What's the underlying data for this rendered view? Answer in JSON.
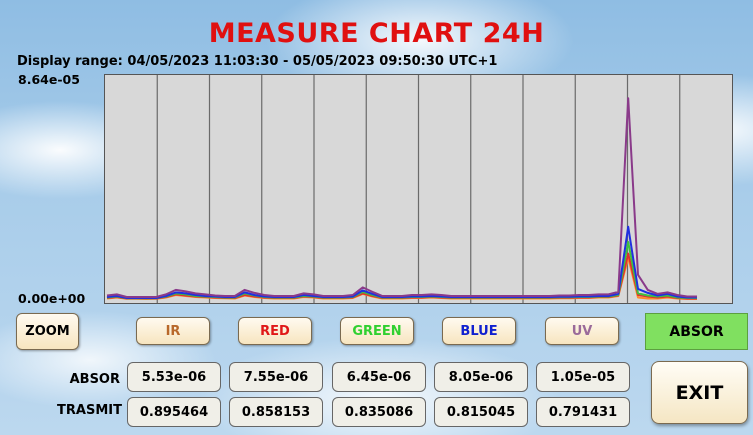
{
  "title": "MEASURE CHART 24H",
  "display_range": "Display range: 04/05/2023 11:03:30 - 05/05/2023 09:50:30 UTC+1",
  "chart_data": {
    "type": "line",
    "y_tick_max": "8.64e-05",
    "y_tick_min": "0.00e+00",
    "ylim": [
      0,
      8.64e-05
    ],
    "x_start": "04/05/2023 11:03:30",
    "x_end": "05/05/2023 09:50:30",
    "vertical_gridlines": 11,
    "series": [
      {
        "color": "#ff8a2a",
        "values": [
          0.3,
          0.5,
          0.25,
          0.25,
          0.2,
          0.25,
          0.5,
          1.0,
          0.8,
          0.6,
          0.5,
          0.4,
          0.35,
          0.3,
          0.9,
          0.6,
          0.4,
          0.3,
          0.3,
          0.3,
          0.6,
          0.5,
          0.3,
          0.3,
          0.3,
          0.4,
          1.2,
          0.7,
          0.3,
          0.3,
          0.3,
          0.4,
          0.4,
          0.5,
          0.4,
          0.3,
          0.3,
          0.3,
          0.3,
          0.3,
          0.3,
          0.3,
          0.3,
          0.3,
          0.3,
          0.3,
          0.35,
          0.35,
          0.4,
          0.4,
          0.5,
          0.5,
          0.8,
          8.4,
          0.5,
          0.3,
          0.3,
          0.5,
          0.3,
          0.2,
          0.2
        ]
      },
      {
        "color": "#e03030",
        "values": [
          0.4,
          0.6,
          0.3,
          0.3,
          0.3,
          0.3,
          0.6,
          1.1,
          0.9,
          0.7,
          0.6,
          0.5,
          0.4,
          0.4,
          1.0,
          0.7,
          0.5,
          0.4,
          0.4,
          0.4,
          0.7,
          0.6,
          0.4,
          0.4,
          0.4,
          0.5,
          1.3,
          0.8,
          0.4,
          0.4,
          0.4,
          0.5,
          0.5,
          0.6,
          0.5,
          0.4,
          0.4,
          0.4,
          0.4,
          0.4,
          0.4,
          0.4,
          0.4,
          0.4,
          0.4,
          0.4,
          0.45,
          0.45,
          0.5,
          0.5,
          0.6,
          0.6,
          0.9,
          9.2,
          1.0,
          0.7,
          0.5,
          0.7,
          0.4,
          0.3,
          0.3
        ]
      },
      {
        "color": "#40c040",
        "values": [
          0.5,
          0.7,
          0.35,
          0.35,
          0.35,
          0.35,
          0.7,
          1.3,
          1.1,
          0.8,
          0.7,
          0.6,
          0.5,
          0.5,
          1.3,
          0.9,
          0.6,
          0.5,
          0.5,
          0.5,
          0.8,
          0.7,
          0.5,
          0.5,
          0.5,
          0.6,
          1.6,
          1.0,
          0.5,
          0.5,
          0.5,
          0.6,
          0.6,
          0.7,
          0.6,
          0.5,
          0.5,
          0.5,
          0.5,
          0.5,
          0.5,
          0.5,
          0.5,
          0.5,
          0.5,
          0.5,
          0.55,
          0.55,
          0.6,
          0.6,
          0.7,
          0.7,
          1.0,
          11.5,
          1.3,
          0.9,
          0.7,
          0.9,
          0.5,
          0.4,
          0.4
        ]
      },
      {
        "color": "#2030e0",
        "values": [
          0.6,
          0.8,
          0.4,
          0.4,
          0.4,
          0.4,
          0.8,
          1.5,
          1.3,
          1.0,
          0.8,
          0.7,
          0.6,
          0.6,
          1.5,
          1.0,
          0.7,
          0.6,
          0.6,
          0.6,
          1.0,
          0.8,
          0.6,
          0.6,
          0.6,
          0.7,
          1.9,
          1.2,
          0.6,
          0.6,
          0.6,
          0.7,
          0.7,
          0.8,
          0.7,
          0.6,
          0.6,
          0.6,
          0.6,
          0.6,
          0.6,
          0.6,
          0.6,
          0.6,
          0.6,
          0.6,
          0.65,
          0.65,
          0.7,
          0.7,
          0.8,
          0.8,
          1.2,
          14.5,
          2.2,
          1.4,
          0.9,
          1.2,
          0.7,
          0.5,
          0.5
        ]
      },
      {
        "color": "#8a3a8a",
        "values": [
          0.9,
          1.1,
          0.6,
          0.6,
          0.6,
          0.6,
          1.1,
          2.0,
          1.7,
          1.3,
          1.1,
          0.9,
          0.8,
          0.8,
          2.0,
          1.4,
          1.0,
          0.8,
          0.8,
          0.8,
          1.3,
          1.1,
          0.8,
          0.8,
          0.8,
          1.0,
          2.5,
          1.6,
          0.8,
          0.8,
          0.8,
          1.0,
          1.0,
          1.1,
          1.0,
          0.8,
          0.8,
          0.8,
          0.8,
          0.8,
          0.8,
          0.8,
          0.8,
          0.8,
          0.8,
          0.8,
          0.9,
          0.9,
          1.0,
          1.0,
          1.1,
          1.1,
          1.6,
          40.0,
          5.0,
          2.0,
          1.2,
          1.5,
          1.0,
          0.7,
          0.7
        ]
      }
    ]
  },
  "buttons": {
    "zoom": "ZOOM",
    "absor": "ABSOR",
    "exit": "EXIT",
    "series": [
      {
        "label": "IR",
        "color": "#b8682a"
      },
      {
        "label": "RED",
        "color": "#e01818"
      },
      {
        "label": "GREEN",
        "color": "#30d030"
      },
      {
        "label": "BLUE",
        "color": "#1020d0"
      },
      {
        "label": "UV",
        "color": "#9a6a9a"
      }
    ]
  },
  "rows": {
    "absor_label": "ABSOR",
    "trasmit_label": "TRASMIT",
    "absor_values": [
      "5.53e-06",
      "7.55e-06",
      "6.45e-06",
      "8.05e-06",
      "1.05e-05"
    ],
    "trasmit_values": [
      "0.895464",
      "0.858153",
      "0.835086",
      "0.815045",
      "0.791431"
    ]
  }
}
